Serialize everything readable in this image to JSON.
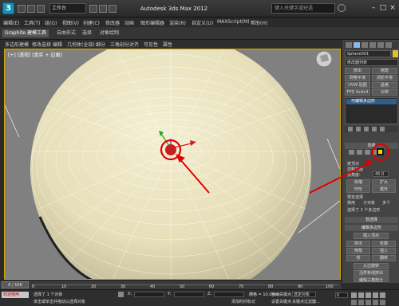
{
  "titlebar": {
    "app_title": "Autodesk 3ds Max 2012",
    "workspace": "工作台",
    "search_placeholder": "键入关键字或短语"
  },
  "menubar": {
    "items": [
      "编辑(E)",
      "工具(T)",
      "组(G)",
      "视图(V)",
      "创建(C)",
      "修改器",
      "动画",
      "图形编辑器",
      "渲染(R)",
      "自定义(U)",
      "MAXScript(M)",
      "帮助(H)"
    ]
  },
  "ribbon": {
    "tabs": [
      "Graphite 建模工具",
      "自由形式",
      "选择",
      "对象绘制"
    ],
    "buttons": [
      "多边形建模",
      "修改选择",
      "编辑",
      "几何体(全部)",
      "细分",
      "三角剖分",
      "对齐",
      "可见性",
      "属性"
    ]
  },
  "viewport": {
    "label": "[+] [透视] [真实 + 边面]"
  },
  "command_panel": {
    "object_name": "Sphere001",
    "modifier_list": "修改器列表",
    "buttons": [
      "挤出",
      "倒角",
      "网格平滑",
      "涡轮平滑",
      "UVW 贴图",
      "晶格",
      "FFD 4x4x4",
      "对称"
    ],
    "stack_item": "可编辑多边形",
    "section_title": "选择",
    "checkbox_labels": [
      "按顶点",
      "忽略背面",
      "按角度:"
    ],
    "angle_value": "45.0",
    "small_buttons": [
      "收缩",
      "扩大",
      "环形",
      "循环"
    ],
    "preview_title": "预览选择",
    "preview_options": [
      "禁用",
      "子对象",
      "多个"
    ],
    "selection_status": "选择了 1 个多边形",
    "soft_selection": "软选择",
    "edit_polygons": "编辑多边形",
    "insert_vertex": "插入顶点",
    "edit_buttons": [
      "挤出",
      "轮廓",
      "倒角",
      "插入",
      "桥",
      "翻转"
    ],
    "hinge": "从边旋转",
    "extrude_spline": "沿样条线挤出",
    "edit_tri": "编辑三角剖分",
    "retri": "重复三角算法",
    "turn": "旋转"
  },
  "timeline": {
    "frame": "0 / 100",
    "ticks": [
      "0",
      "10",
      "20",
      "30",
      "40",
      "50",
      "60",
      "70",
      "80",
      "90",
      "100"
    ]
  },
  "statusbar": {
    "script_label": "欢迎使用",
    "status_line1": "选择了 1 个对象",
    "status_line2": "单击或单击并拖动以选择对象",
    "x_label": "X:",
    "y_label": "Y:",
    "z_label": "Z:",
    "grid": "栅格 = 10.0mm",
    "add_tag": "添加时间标记",
    "auto_key": "自动关键点",
    "set_key": "设置关键点",
    "selected": "选定对象",
    "key_filters": "关键点过滤器...",
    "frame_value": "0"
  },
  "colors": {
    "sphere": "#e6dfb9",
    "annotation": "#e10000",
    "viewport_bg": "#808080",
    "viewport_border": "#d9a800"
  }
}
